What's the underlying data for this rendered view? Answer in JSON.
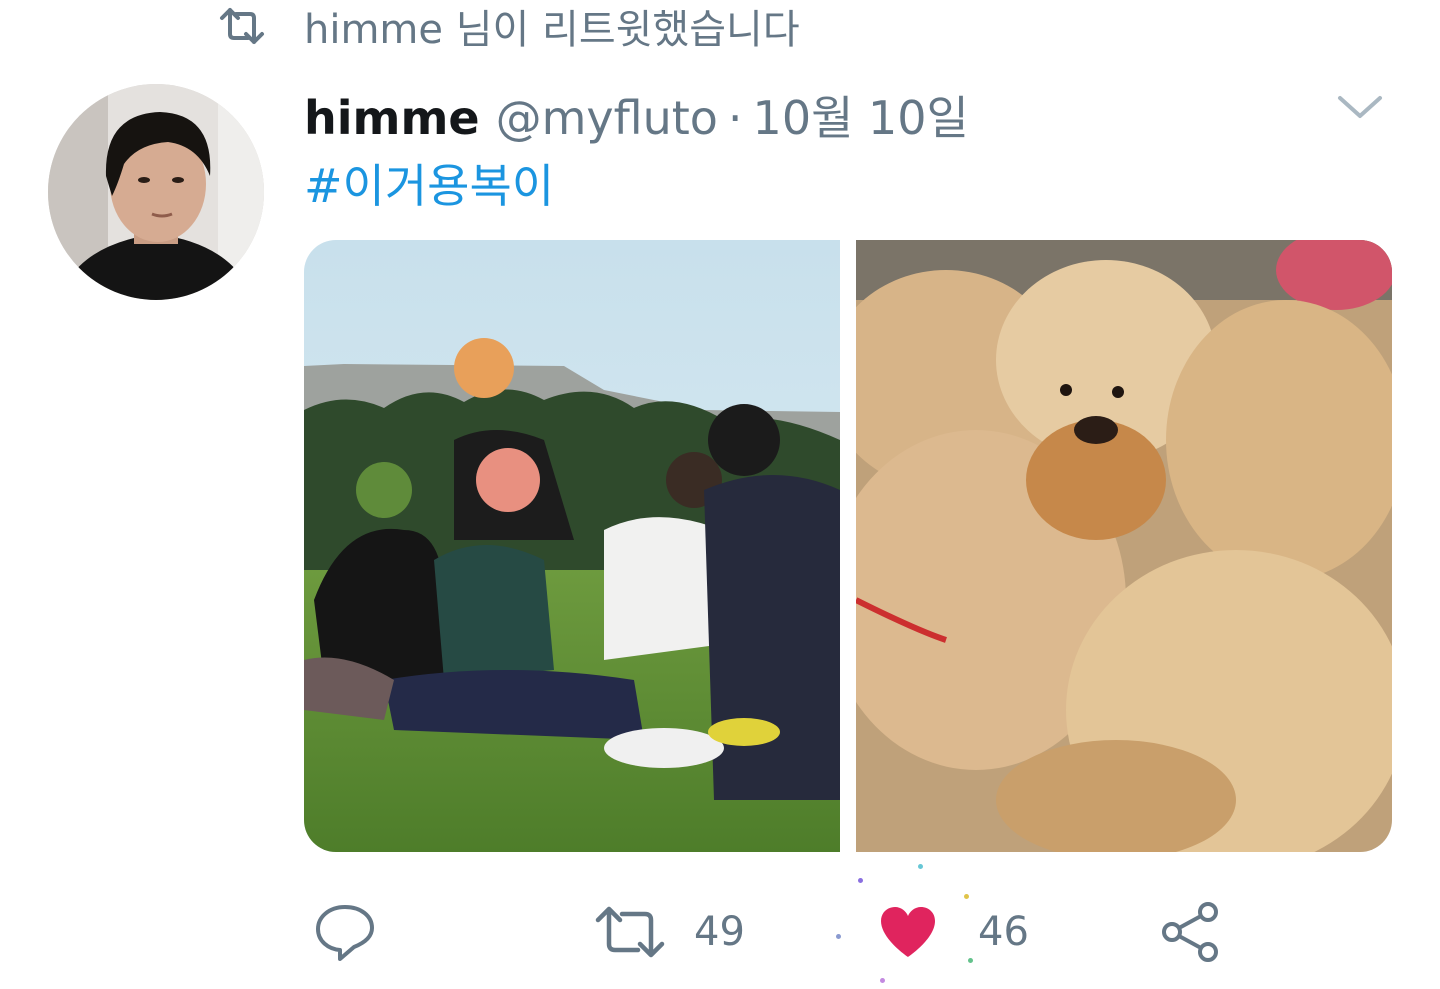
{
  "retweet_context": {
    "text": "himme 님이 리트윗했습니다",
    "icon": "retweet-icon"
  },
  "tweet": {
    "display_name": "himme",
    "handle": "@myfluto",
    "separator": "·",
    "date": "10월 10일",
    "hashtag": "#이거용복이",
    "caret_icon": "chevron-down-icon"
  },
  "media": [
    {
      "description_icon": "group-photo",
      "kind": "photo"
    },
    {
      "description_icon": "puppies-photo",
      "kind": "photo"
    }
  ],
  "actions": {
    "reply_icon": "reply-icon",
    "retweet_icon": "retweet-icon",
    "retweet_count": "49",
    "like_icon": "heart-icon",
    "like_count": "46",
    "share_icon": "share-icon"
  },
  "colors": {
    "secondary_text": "#657786",
    "primary_text": "#14171a",
    "link": "#1b95e0",
    "like": "#e0245e"
  }
}
